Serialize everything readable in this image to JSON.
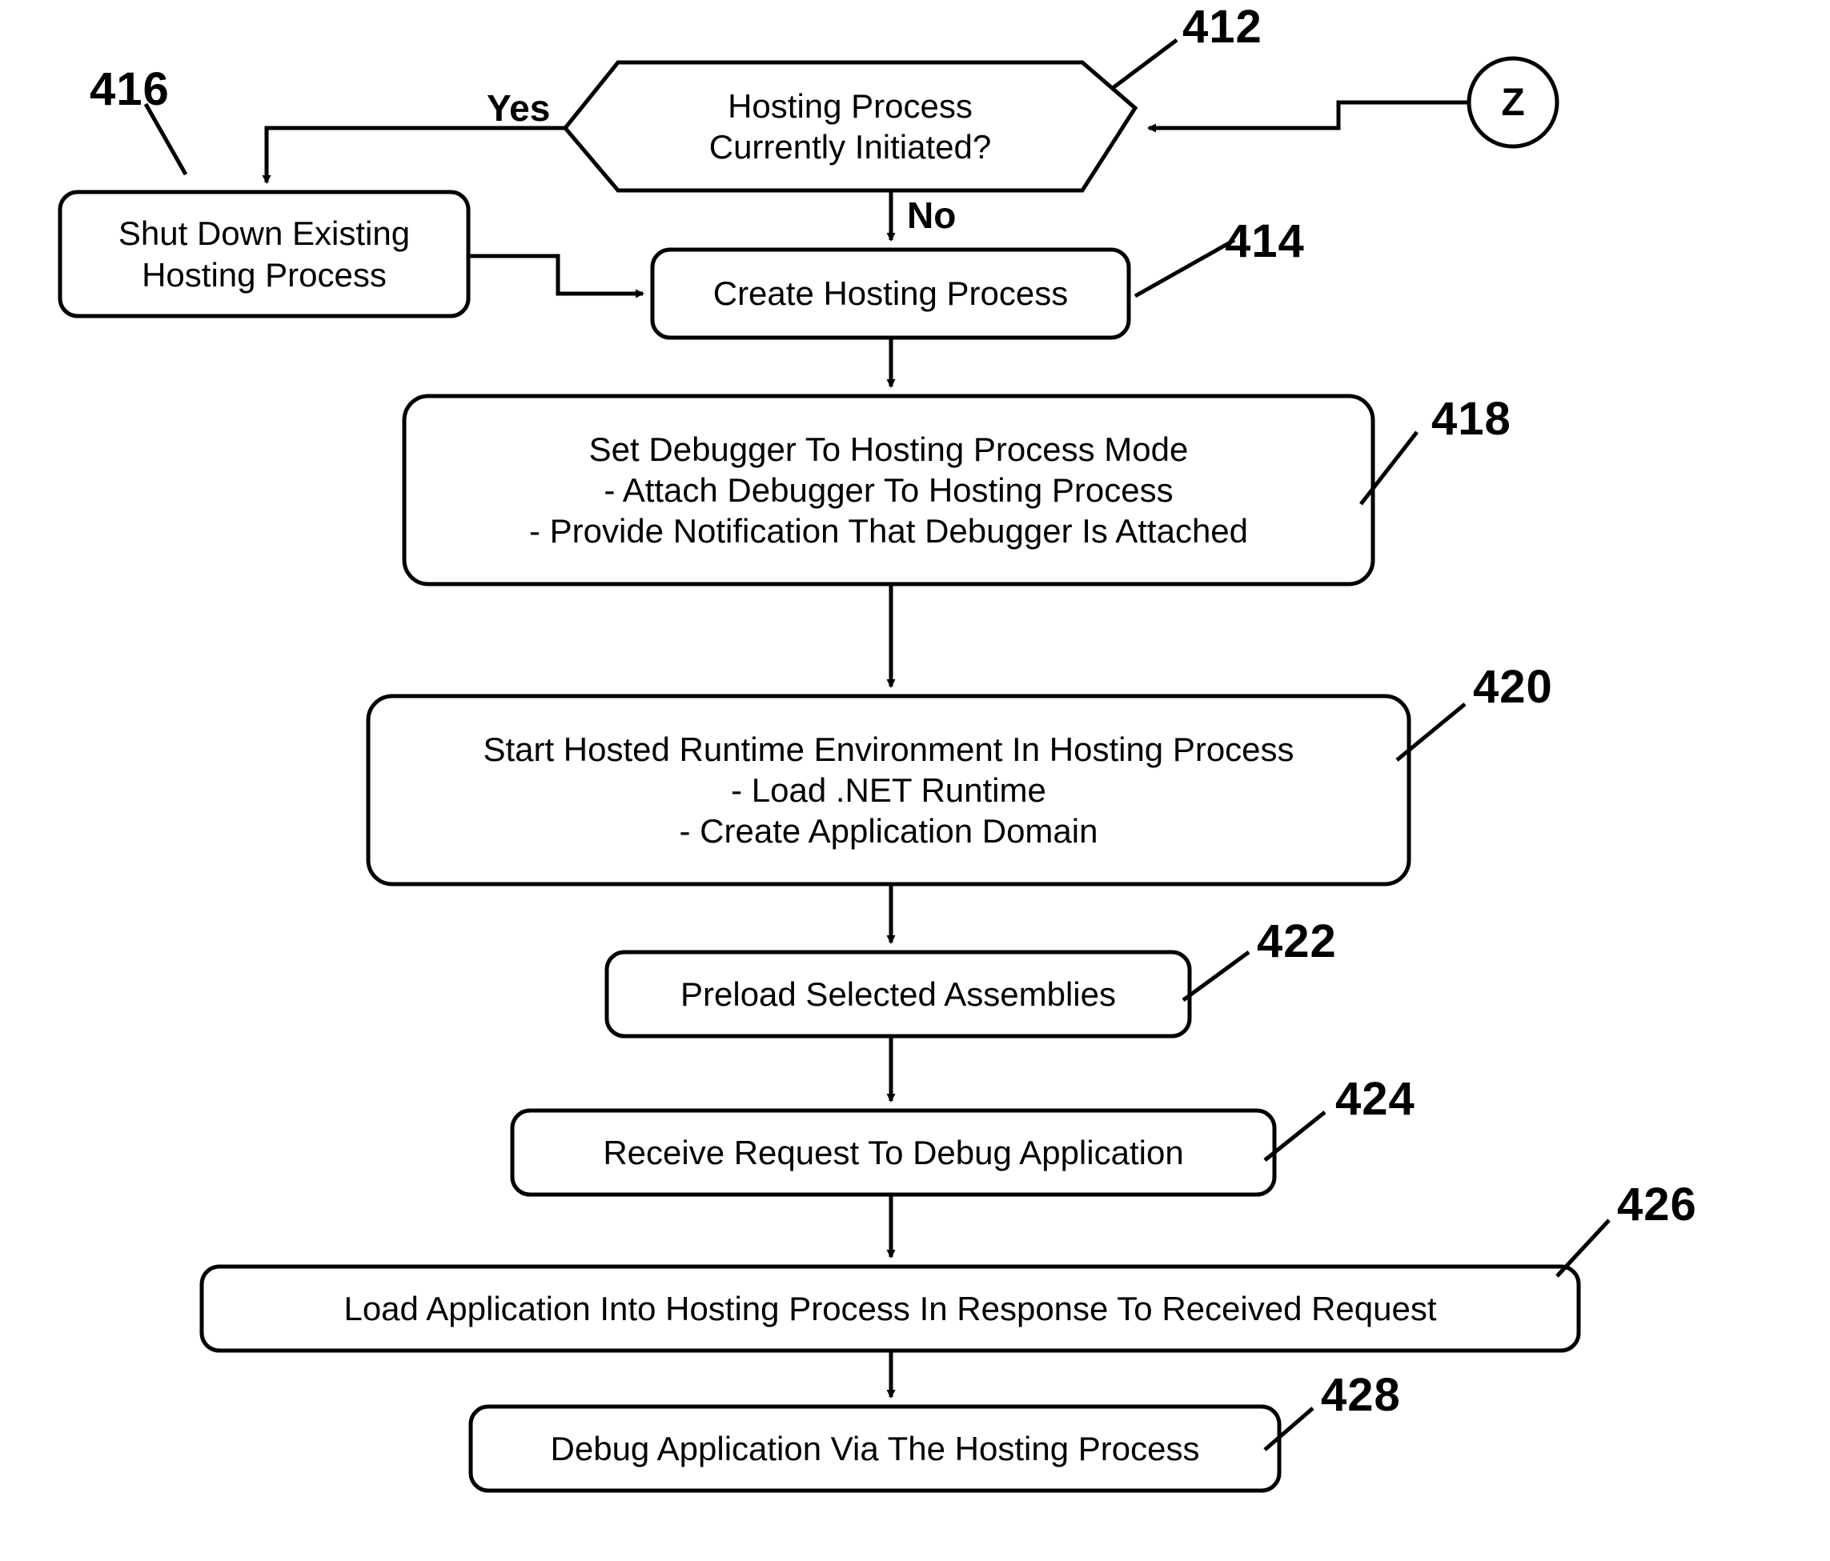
{
  "figure": {
    "type": "flowchart",
    "title": "",
    "nodes": [
      {
        "id": "decision_412",
        "shape": "decision-hexagon",
        "ref": "412",
        "lines": [
          "Hosting Process",
          "Currently Initiated?"
        ]
      },
      {
        "id": "shutdown_416",
        "shape": "rounded-rect",
        "ref": "416",
        "lines": [
          "Shut Down Existing",
          "Hosting Process"
        ]
      },
      {
        "id": "create_414",
        "shape": "rounded-rect",
        "ref": "414",
        "lines": [
          "Create Hosting Process"
        ]
      },
      {
        "id": "setdebugger_418",
        "shape": "rounded-rect",
        "ref": "418",
        "lines": [
          "Set Debugger To Hosting Process Mode",
          "- Attach Debugger To Hosting Process",
          "- Provide Notification That Debugger Is Attached"
        ]
      },
      {
        "id": "startruntime_420",
        "shape": "rounded-rect",
        "ref": "420",
        "lines": [
          "Start Hosted Runtime Environment In Hosting Process",
          "- Load .NET Runtime",
          "- Create Application Domain"
        ]
      },
      {
        "id": "preload_422",
        "shape": "rounded-rect",
        "ref": "422",
        "lines": [
          "Preload Selected Assemblies"
        ]
      },
      {
        "id": "receive_424",
        "shape": "rounded-rect",
        "ref": "424",
        "lines": [
          "Receive Request To Debug Application"
        ]
      },
      {
        "id": "load_426",
        "shape": "rounded-rect",
        "ref": "426",
        "lines": [
          "Load Application Into Hosting Process In Response To Received Request"
        ]
      },
      {
        "id": "debug_428",
        "shape": "rounded-rect",
        "ref": "428",
        "lines": [
          "Debug Application Via The Hosting Process"
        ]
      },
      {
        "id": "connector_z",
        "shape": "circle-connector",
        "ref": "",
        "lines": [
          "Z"
        ]
      }
    ],
    "edge_labels": [
      {
        "id": "yes-label",
        "text": "Yes"
      },
      {
        "id": "no-label",
        "text": "No"
      }
    ],
    "reference_numerals": [
      "412",
      "414",
      "416",
      "418",
      "420",
      "422",
      "424",
      "426",
      "428"
    ],
    "colors": {
      "stroke": "#000000",
      "fill": "#ffffff",
      "text": "#000000"
    }
  }
}
